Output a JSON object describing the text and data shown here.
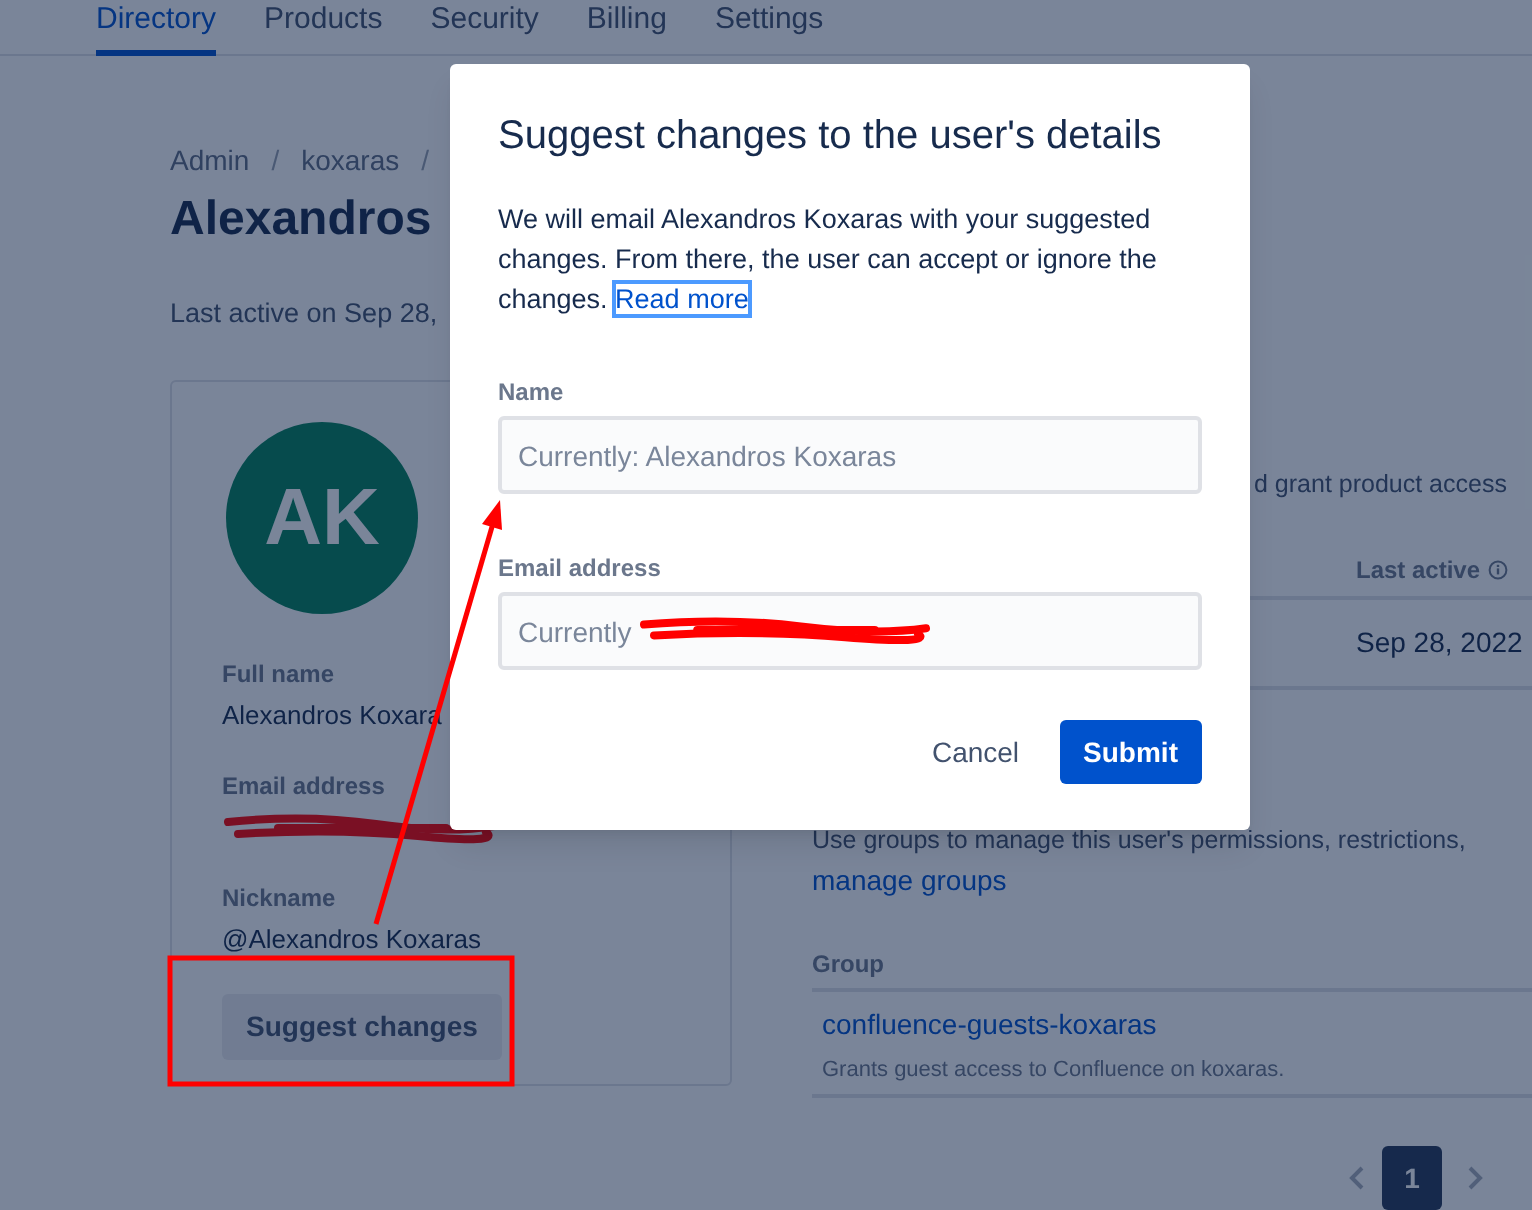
{
  "nav_tabs": [
    {
      "label": "Directory",
      "selected": true
    },
    {
      "label": "Products",
      "selected": false
    },
    {
      "label": "Security",
      "selected": false
    },
    {
      "label": "Billing",
      "selected": false
    },
    {
      "label": "Settings",
      "selected": false
    }
  ],
  "breadcrumb": [
    {
      "kind": "link",
      "text": "Admin"
    },
    {
      "kind": "separator",
      "text": "/"
    },
    {
      "kind": "link",
      "text": "koxaras"
    },
    {
      "kind": "separator",
      "text": "/"
    }
  ],
  "page_title": "Alexandros",
  "last_active": "Last active on Sep 28,",
  "profile_card": {
    "avatar_initials": "AK",
    "fields": [
      {
        "label": "Full name",
        "value": "Alexandros Koxara",
        "redacted": false
      },
      {
        "label": "Email address",
        "redacted": true
      },
      {
        "label": "Nickname",
        "value": "@Alexandros Koxaras",
        "redacted": false
      }
    ],
    "button": "Suggest changes"
  },
  "products_note": "d grant product access",
  "products_table": {
    "columns": [
      "Last active"
    ],
    "rows": [
      [
        "Sep 28, 2022"
      ]
    ]
  },
  "groups": {
    "description": "Use groups to manage this user's permissions, restrictions,",
    "link": "manage groups",
    "column": "Group",
    "rows": [
      {
        "name": "confluence-guests-koxaras",
        "description": "Grants guest access to Confluence on koxaras."
      }
    ]
  },
  "pagination": {
    "pages": [
      {
        "label": "1",
        "selected": true
      }
    ]
  },
  "dialog": {
    "title": "Suggest changes to the user's details",
    "text": "We will email Alexandros Koxaras with your suggested changes. From there, the user can accept or ignore the changes.",
    "link": "Read more",
    "fields": [
      {
        "label": "Name",
        "placeholder": "Currently: Alexandros Koxaras",
        "redacted": false
      },
      {
        "label": "Email address",
        "placeholder": "Currently",
        "redacted": true
      }
    ],
    "buttons": [
      {
        "label": "Cancel",
        "kind": "subtle"
      },
      {
        "label": "Submit",
        "kind": "primary"
      }
    ]
  }
}
